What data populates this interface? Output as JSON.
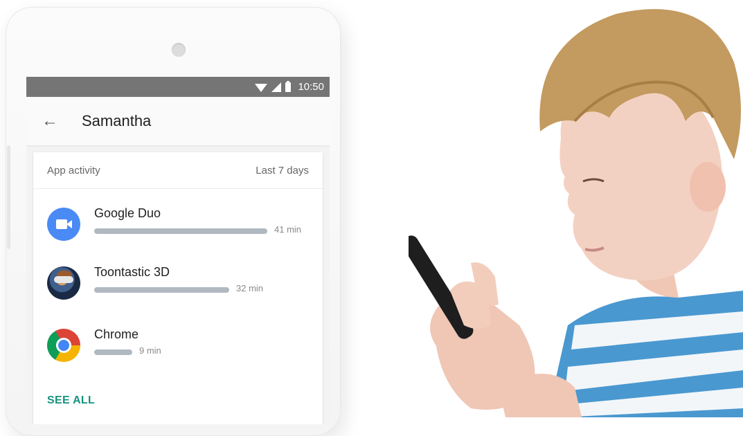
{
  "status_bar": {
    "time": "10:50"
  },
  "app_bar": {
    "title": "Samantha"
  },
  "card": {
    "header_left": "App activity",
    "header_right": "Last 7 days",
    "apps": [
      {
        "name": "Google Duo",
        "time": "41 min",
        "minutes": 41
      },
      {
        "name": "Toontastic 3D",
        "time": "32 min",
        "minutes": 32
      },
      {
        "name": "Chrome",
        "time": "9 min",
        "minutes": 9
      }
    ],
    "see_all": "SEE ALL"
  },
  "colors": {
    "status_bar": "#757575",
    "accent": "#16937f",
    "bar": "#b0b8c0",
    "duo_blue": "#4a8af4",
    "shirt_blue": "#4a98d0"
  },
  "icons": [
    "arrow-left-icon",
    "wifi-icon",
    "signal-icon",
    "battery-icon",
    "google-duo-icon",
    "toontastic-icon",
    "chrome-icon"
  ]
}
